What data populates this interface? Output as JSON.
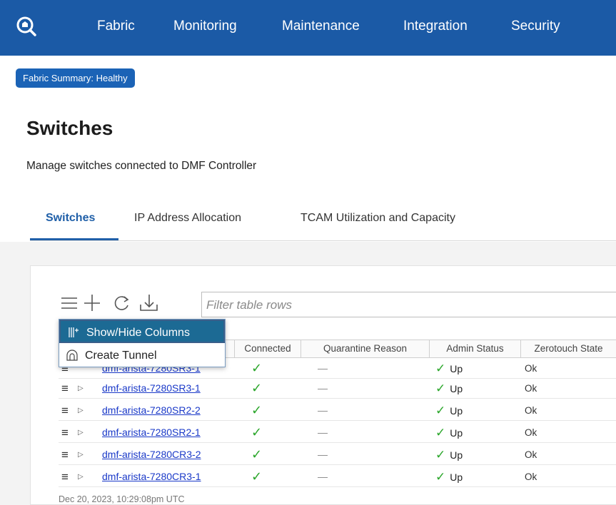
{
  "nav": {
    "items": [
      "Fabric",
      "Monitoring",
      "Maintenance",
      "Integration",
      "Security"
    ]
  },
  "status_pill": "Fabric Summary: Healthy",
  "page": {
    "title": "Switches",
    "subtitle": "Manage switches connected to DMF Controller"
  },
  "tabs": [
    "Switches",
    "IP Address Allocation",
    "TCAM Utilization and Capacity"
  ],
  "active_tab": "Switches",
  "toolbar": {
    "icons": [
      "menu-icon",
      "add-icon",
      "refresh-icon",
      "download-icon"
    ],
    "filter_placeholder": "Filter table rows"
  },
  "table": {
    "headers": [
      "Connected",
      "Quarantine Reason",
      "Admin Status",
      "Zerotouch State"
    ],
    "rows": [
      {
        "name": "dmf-arista-7280SR3-1",
        "connected": "✓",
        "quarantine": "—",
        "admin": "Up",
        "zerotouch": "Ok"
      },
      {
        "name": "dmf-arista-7280SR2-2",
        "connected": "✓",
        "quarantine": "—",
        "admin": "Up",
        "zerotouch": "Ok"
      },
      {
        "name": "dmf-arista-7280SR2-1",
        "connected": "✓",
        "quarantine": "—",
        "admin": "Up",
        "zerotouch": "Ok"
      },
      {
        "name": "dmf-arista-7280CR3-2",
        "connected": "✓",
        "quarantine": "—",
        "admin": "Up",
        "zerotouch": "Ok"
      },
      {
        "name": "dmf-arista-7280CR3-1",
        "connected": "✓",
        "quarantine": "—",
        "admin": "Up",
        "zerotouch": "Ok"
      }
    ],
    "partial_row": {
      "name": "dmf-arista-7280SR3-1",
      "connected": "✓",
      "quarantine": "—",
      "admin": "Up",
      "zerotouch": "Ok"
    }
  },
  "menu": {
    "items": [
      "Show/Hide Columns",
      "Create Tunnel"
    ]
  },
  "timestamp": "Dec 20, 2023, 10:29:08pm UTC",
  "colors": {
    "nav_bg": "#1b5aa6",
    "accent": "#1f5fa8",
    "link": "#1a39c8",
    "check": "#2aa62a",
    "menu_highlight": "#1c6a94"
  }
}
